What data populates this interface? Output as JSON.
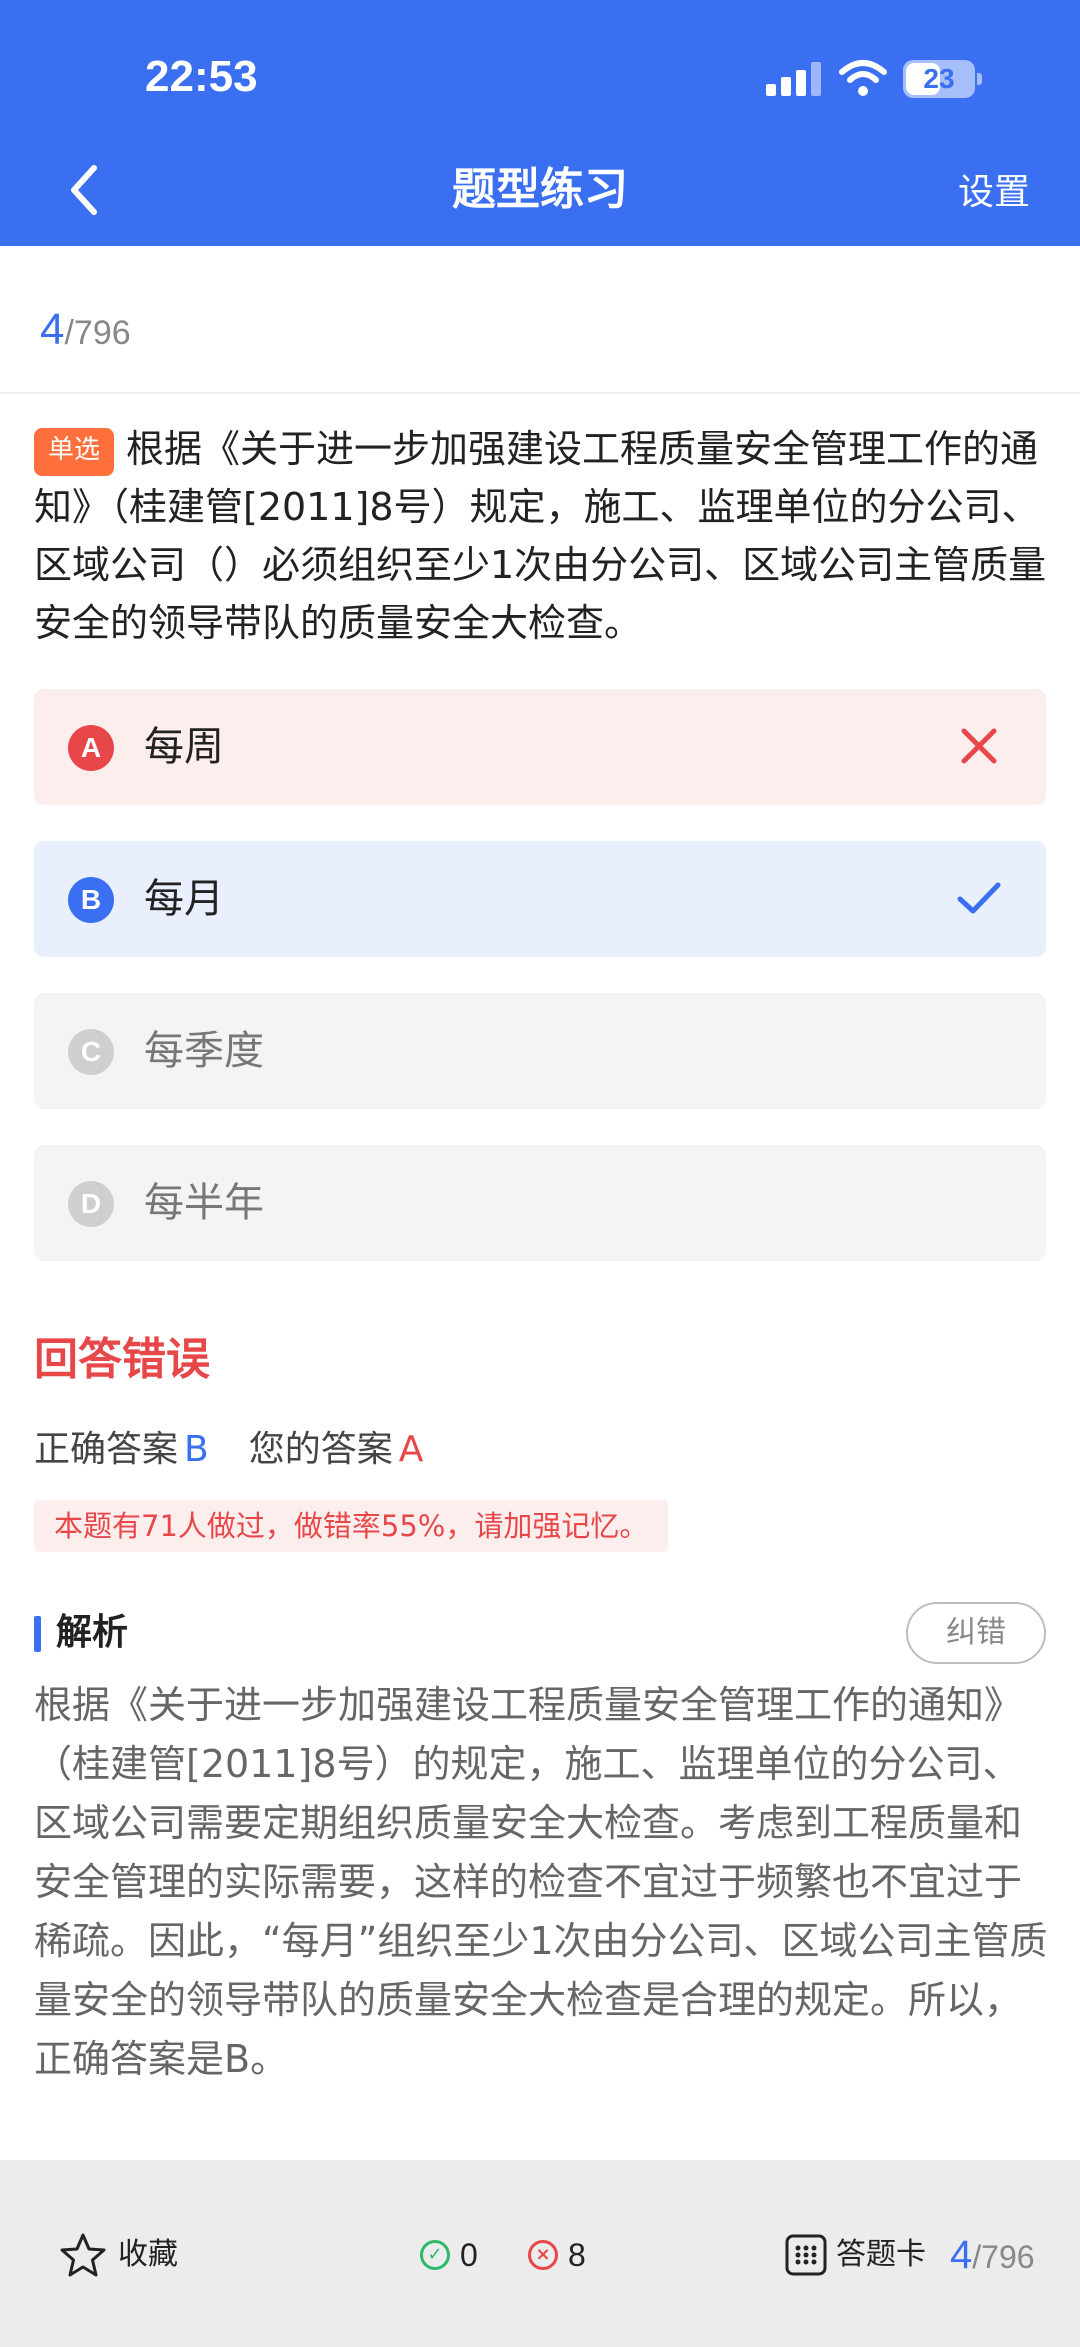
{
  "status_bar": {
    "time": "22:53",
    "battery": "23"
  },
  "nav": {
    "title": "题型练习",
    "settings": "设置"
  },
  "progress": {
    "current": "4",
    "total": "/796"
  },
  "question": {
    "type_badge": "单选",
    "text": "根据《关于进一步加强建设工程质量安全管理工作的通知》（桂建管[2011]8号）规定，施工、监理单位的分公司、区域公司（）必须组织至少1次由分公司、区域公司主管质量安全的领导带队的质量安全大检查。"
  },
  "options": [
    {
      "letter": "A",
      "text": "每周",
      "state": "wrong"
    },
    {
      "letter": "B",
      "text": "每月",
      "state": "correct"
    },
    {
      "letter": "C",
      "text": "每季度",
      "state": "neutral"
    },
    {
      "letter": "D",
      "text": "每半年",
      "state": "neutral"
    }
  ],
  "result": {
    "title": "回答错误",
    "correct_label": "正确答案",
    "correct_value": "B",
    "yours_label": "您的答案",
    "yours_value": "A",
    "stat_note": "本题有71人做过，做错率55%，请加强记忆。"
  },
  "analysis": {
    "title": "解析",
    "report_button": "纠错",
    "body": "根据《关于进一步加强建设工程质量安全管理工作的通知》（桂建管[2011]8号）的规定，施工、监理单位的分公司、区域公司需要定期组织质量安全大检查。考虑到工程质量和安全管理的实际需要，这样的检查不宜过于频繁也不宜过于稀疏。因此，“每月”组织至少1次由分公司、区域公司主管质量安全的领导带队的质量安全大检查是合理的规定。所以，正确答案是B。"
  },
  "bottom_bar": {
    "favorite": "收藏",
    "correct_count": "0",
    "wrong_count": "8",
    "answer_card": "答题卡",
    "page_current": "4",
    "page_total": "/796"
  },
  "colors": {
    "primary": "#3a6ff2",
    "error": "#e8474a",
    "success": "#2eb86a",
    "badge": "#ff6f3c"
  },
  "icons": {
    "back": "chevron-left-icon",
    "wrong": "close-icon",
    "right": "check-icon",
    "favorite": "star-icon",
    "answer_card": "grid-icon"
  }
}
